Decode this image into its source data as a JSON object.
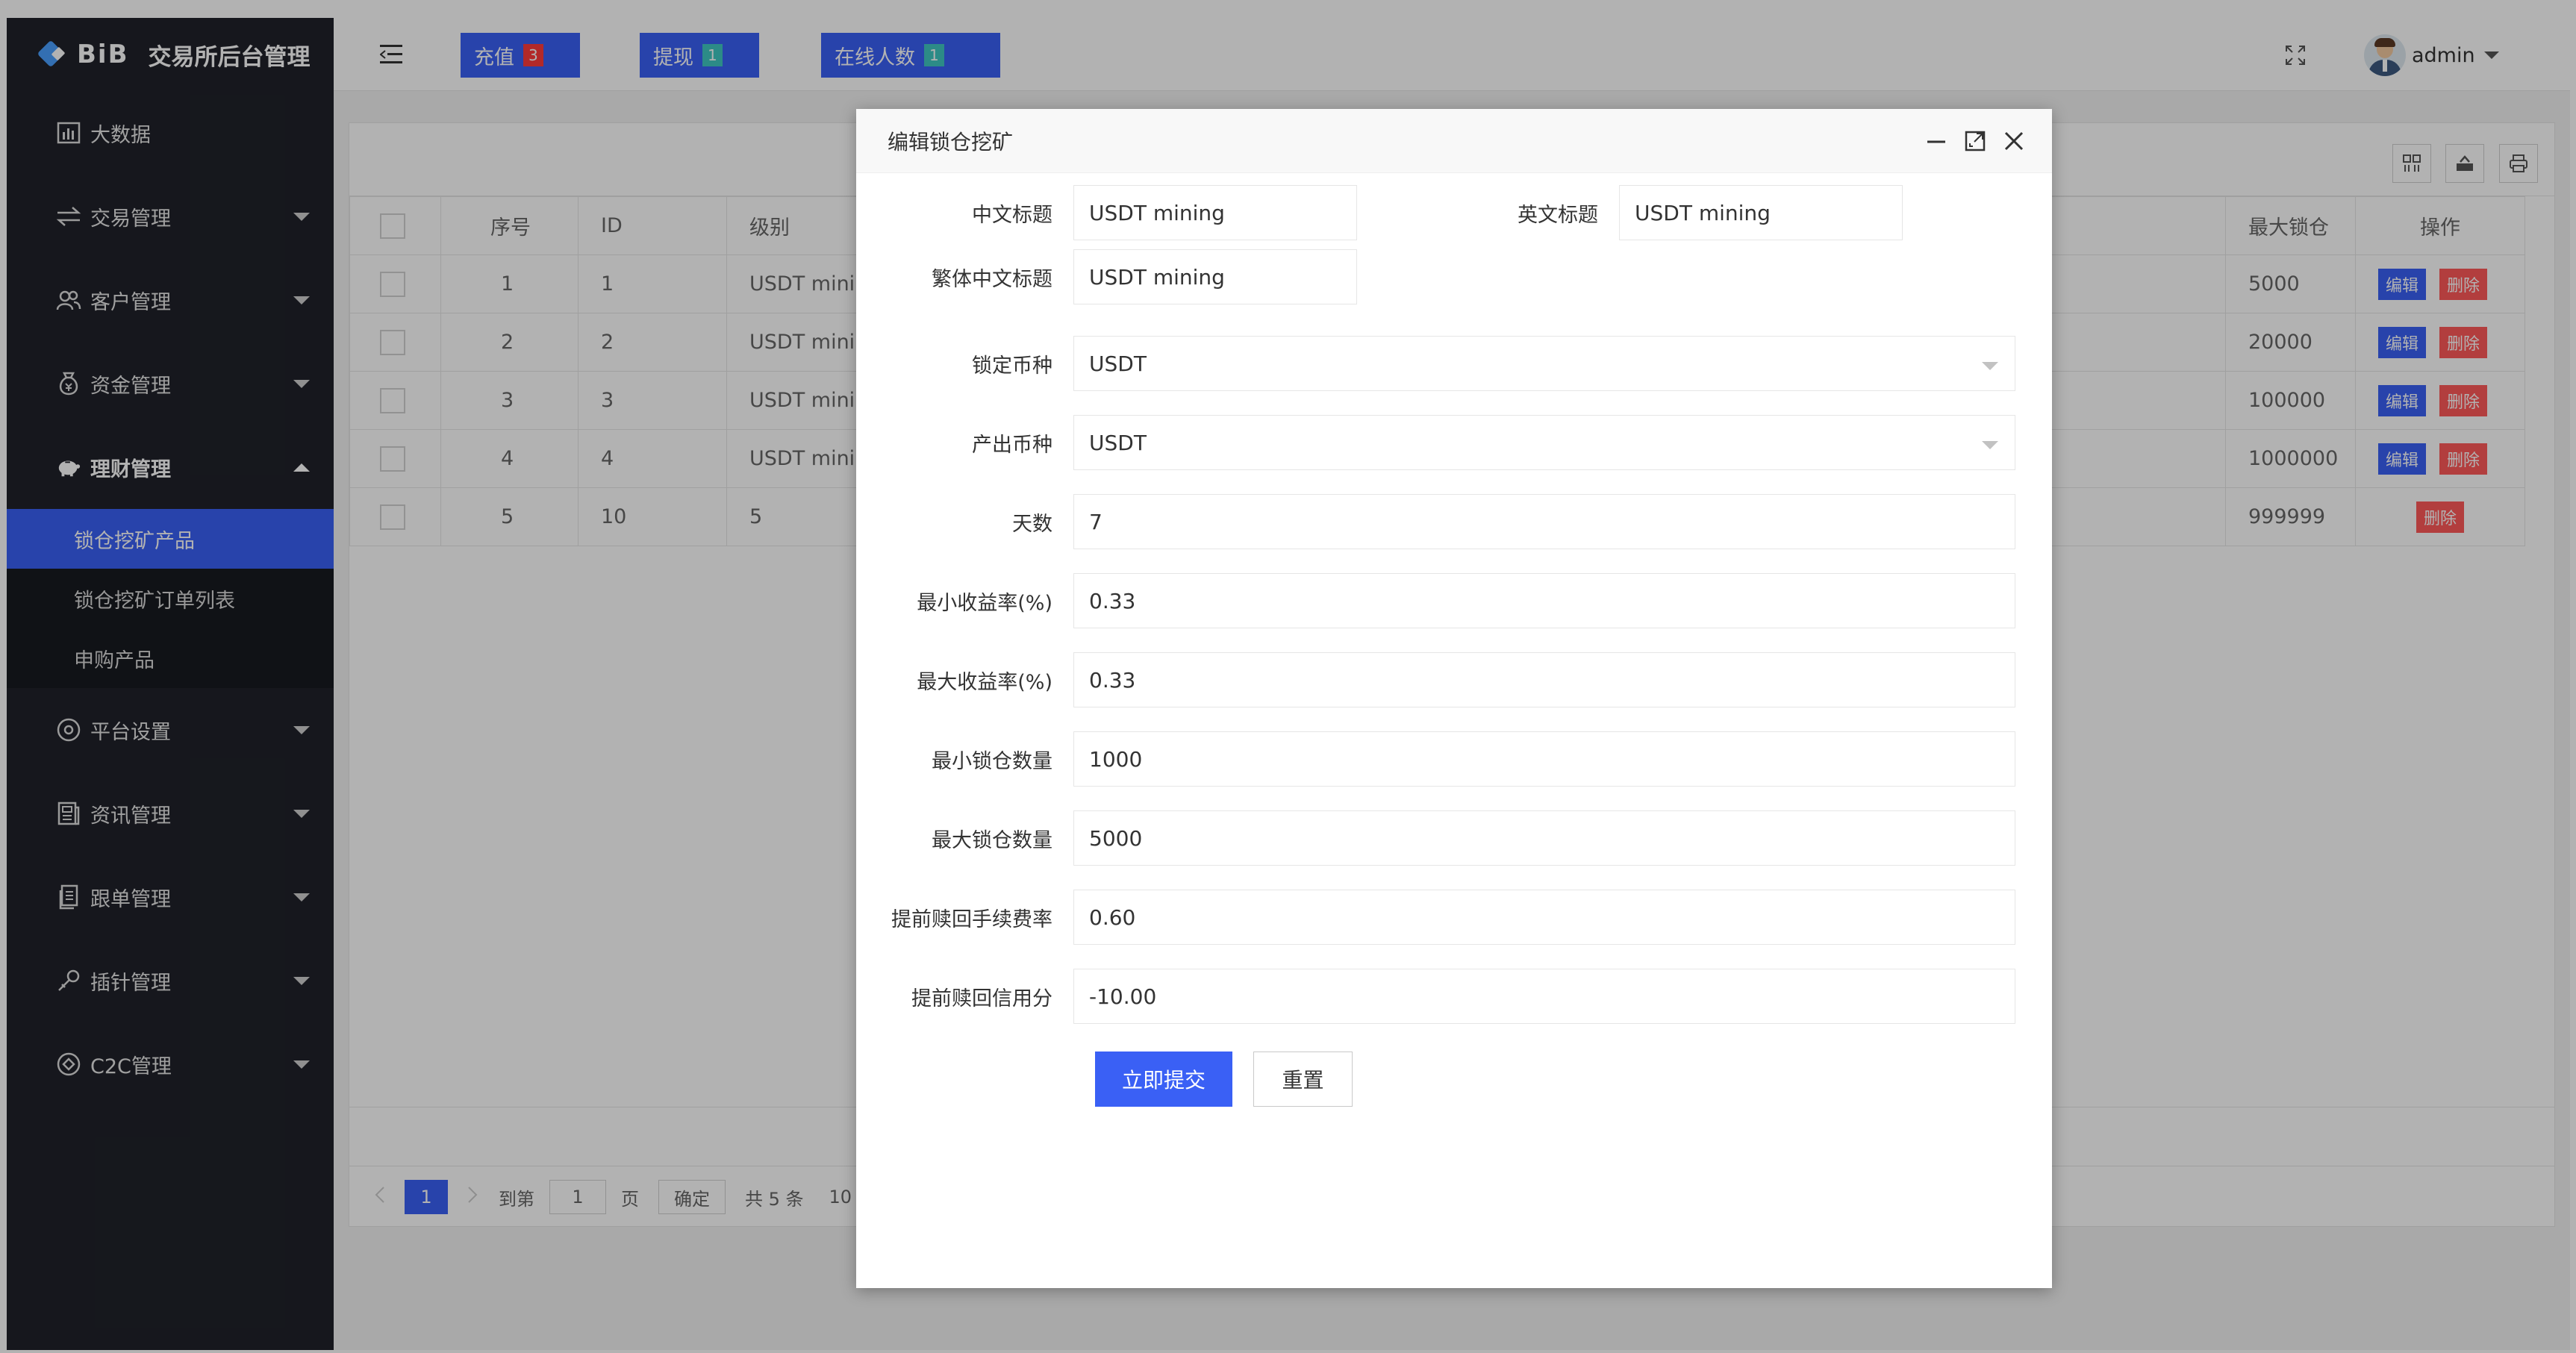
{
  "brand": {
    "logo_text": "BiB",
    "title": "交易所后台管理"
  },
  "sidebar": {
    "items": [
      {
        "label": "大数据",
        "icon": "bar-chart-icon",
        "has_arrow": false
      },
      {
        "label": "交易管理",
        "icon": "transfer-icon",
        "has_arrow": true
      },
      {
        "label": "客户管理",
        "icon": "users-icon",
        "has_arrow": true
      },
      {
        "label": "资金管理",
        "icon": "money-bag-icon",
        "has_arrow": true
      },
      {
        "label": "理财管理",
        "icon": "piggy-bank-icon",
        "has_arrow": true,
        "open": true
      },
      {
        "label": "平台设置",
        "icon": "settings-icon",
        "has_arrow": true
      },
      {
        "label": "资讯管理",
        "icon": "news-icon",
        "has_arrow": true
      },
      {
        "label": "跟单管理",
        "icon": "document-icon",
        "has_arrow": true
      },
      {
        "label": "插针管理",
        "icon": "needle-icon",
        "has_arrow": true
      },
      {
        "label": "C2C管理",
        "icon": "c2c-icon",
        "has_arrow": true
      }
    ],
    "submenu": [
      {
        "label": "锁仓挖矿产品",
        "active": true
      },
      {
        "label": "锁仓挖矿订单列表",
        "active": false
      },
      {
        "label": "申购产品",
        "active": false
      }
    ]
  },
  "header": {
    "buttons": [
      {
        "label": "充值",
        "badge": "3",
        "badge_color": "#ff3b3b"
      },
      {
        "label": "提现",
        "badge": "1",
        "badge_color": "#40c7c2"
      },
      {
        "label": "在线人数",
        "badge": "1",
        "badge_color": "#40c7c2"
      }
    ],
    "user": "admin"
  },
  "table": {
    "columns": [
      "序号",
      "ID",
      "级别",
      "最大锁仓",
      "操作"
    ],
    "rows": [
      {
        "seq": "1",
        "id": "1",
        "level": "USDT minir",
        "max": "5000",
        "edit": true
      },
      {
        "seq": "2",
        "id": "2",
        "level": "USDT minir",
        "max": "20000",
        "edit": true
      },
      {
        "seq": "3",
        "id": "3",
        "level": "USDT minir",
        "max": "100000",
        "edit": true
      },
      {
        "seq": "4",
        "id": "4",
        "level": "USDT minir",
        "max": "1000000",
        "edit": true
      },
      {
        "seq": "5",
        "id": "10",
        "level": "5",
        "max": "999999",
        "edit": false
      }
    ],
    "edit_label": "编辑",
    "delete_label": "删除"
  },
  "pager": {
    "current": "1",
    "goto_label": "到第",
    "page_input": "1",
    "page_unit": "页",
    "confirm": "确定",
    "total": "共 5 条",
    "size_partial": "10"
  },
  "modal": {
    "title": "编辑锁仓挖矿",
    "fields": {
      "cn_title": {
        "label": "中文标题",
        "value": "USDT mining"
      },
      "en_title": {
        "label": "英文标题",
        "value": "USDT mining"
      },
      "tw_title": {
        "label": "繁体中文标题",
        "value": "USDT mining"
      },
      "lock_coin": {
        "label": "锁定币种",
        "value": "USDT"
      },
      "out_coin": {
        "label": "产出币种",
        "value": "USDT"
      },
      "days": {
        "label": "天数",
        "value": "7"
      },
      "min_rate": {
        "label": "最小收益率(%)",
        "value": "0.33"
      },
      "max_rate": {
        "label": "最大收益率(%)",
        "value": "0.33"
      },
      "min_lock": {
        "label": "最小锁仓数量",
        "value": "1000"
      },
      "max_lock": {
        "label": "最大锁仓数量",
        "value": "5000"
      },
      "early_fee": {
        "label": "提前赎回手续费率",
        "value": "0.60"
      },
      "early_credit": {
        "label": "提前赎回信用分",
        "value": "-10.00"
      }
    },
    "submit": "立即提交",
    "reset": "重置"
  },
  "colors": {
    "primary": "#3a60f5",
    "sidebar": "#20222a",
    "danger": "#ff5a5a"
  }
}
